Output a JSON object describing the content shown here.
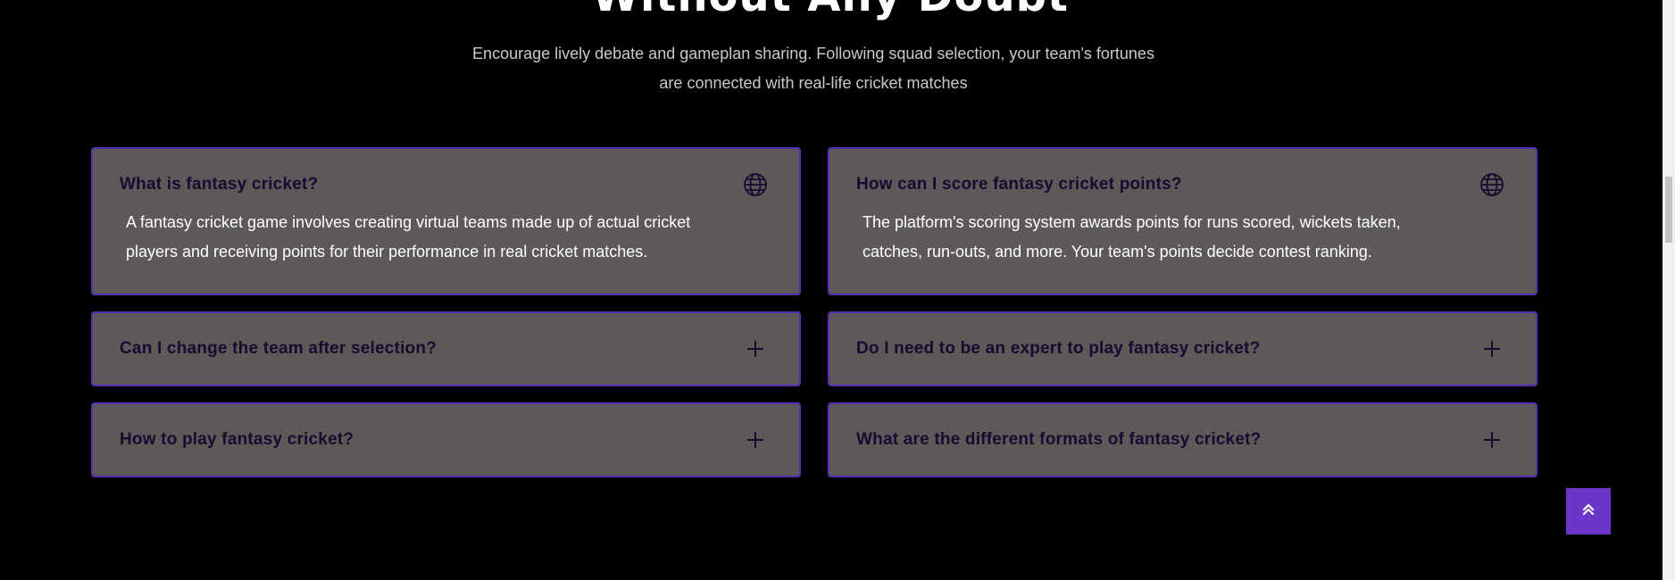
{
  "section": {
    "heading": "Without Any Doubt",
    "subtitle": "Encourage lively debate and gameplan sharing. Following squad selection, your team's fortunes are connected with real-life cricket matches"
  },
  "faqs": [
    {
      "question": "What is fantasy cricket?",
      "answer": "A fantasy cricket game involves creating virtual teams made up of actual cricket players and receiving points for their performance in real cricket matches.",
      "expanded": true,
      "icon": "globe-icon"
    },
    {
      "question": "How can I score fantasy cricket points?",
      "answer": "The platform's scoring system awards points for runs scored, wickets taken, catches, run-outs, and more. Your team's points decide contest ranking.",
      "expanded": true,
      "icon": "globe-icon"
    },
    {
      "question": "Can I change the team after selection?",
      "expanded": false,
      "icon": "plus-icon"
    },
    {
      "question": "Do I need to be an expert to play fantasy cricket?",
      "expanded": false,
      "icon": "plus-icon"
    },
    {
      "question": "How to play fantasy cricket?",
      "expanded": false,
      "icon": "plus-icon"
    },
    {
      "question": "What are the different formats of fantasy cricket?",
      "expanded": false,
      "icon": "plus-icon"
    }
  ],
  "back_to_top": {
    "icon": "double-chevron-up-icon"
  },
  "colors": {
    "background": "#000000",
    "card": "#5d5959",
    "card_border": "#5a2fb0",
    "question_text": "#160b30",
    "accent": "#6b35c9"
  }
}
